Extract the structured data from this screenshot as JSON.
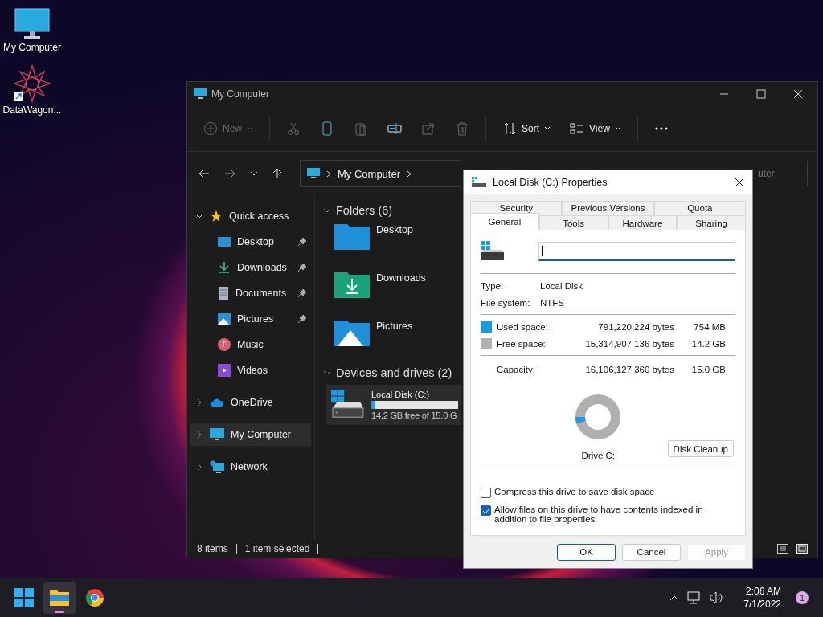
{
  "desktop_icons": [
    {
      "label": "My Computer",
      "kind": "computer"
    },
    {
      "label": "DataWagon...",
      "kind": "app"
    }
  ],
  "explorer": {
    "title": "My Computer",
    "toolbar": [
      {
        "kind": "new",
        "label": "New",
        "disabled": true
      },
      {
        "kind": "cut",
        "disabled": true
      },
      {
        "kind": "copy",
        "disabled": false
      },
      {
        "kind": "paste",
        "disabled": true
      },
      {
        "kind": "rename",
        "disabled": false
      },
      {
        "kind": "share",
        "disabled": true
      },
      {
        "kind": "delete",
        "disabled": true
      },
      {
        "kind": "sort",
        "label": "Sort",
        "disabled": false
      },
      {
        "kind": "view",
        "label": "View",
        "disabled": false
      },
      {
        "kind": "more",
        "disabled": false
      }
    ],
    "address": {
      "path": "My Computer"
    },
    "search": {
      "placeholder": "uter"
    },
    "sidebar": [
      {
        "label": "Quick access",
        "kind": "star",
        "expanded": true,
        "selected": false,
        "children": [
          {
            "label": "Desktop",
            "kind": "desktop",
            "pinned": true,
            "selected": false
          },
          {
            "label": "Downloads",
            "kind": "download",
            "pinned": true,
            "selected": false
          },
          {
            "label": "Documents",
            "kind": "document",
            "pinned": true,
            "selected": false
          },
          {
            "label": "Pictures",
            "kind": "picture",
            "pinned": true,
            "selected": false
          },
          {
            "label": "Music",
            "kind": "music",
            "pinned": false,
            "selected": false
          },
          {
            "label": "Videos",
            "kind": "video",
            "pinned": false,
            "selected": false
          }
        ]
      },
      {
        "label": "OneDrive",
        "kind": "cloud",
        "expanded": false,
        "selected": false
      },
      {
        "label": "My Computer",
        "kind": "computer",
        "expanded": false,
        "selected": true
      },
      {
        "label": "Network",
        "kind": "network",
        "expanded": false,
        "selected": false
      }
    ],
    "sections": [
      {
        "title": "Folders (6)",
        "expanded": true,
        "items": [
          {
            "name": "Desktop",
            "kind": "desktop"
          },
          {
            "name": "Downloads",
            "kind": "download"
          },
          {
            "name": "Pictures",
            "kind": "picture"
          }
        ]
      },
      {
        "title": "Devices and drives (2)",
        "expanded": true,
        "drives": [
          {
            "name": "Local Disk (C:)",
            "level": 0.05,
            "free": "14.2 GB free of 15.0 G",
            "selected": true
          }
        ]
      }
    ],
    "status_bar": [
      "8 items",
      "1 item selected"
    ]
  },
  "dialog": {
    "title": "Local Disk (C:) Properties",
    "tab_rows": [
      [
        {
          "label": "Security",
          "selected": false
        },
        {
          "label": "Previous Versions",
          "selected": false
        },
        {
          "label": "Quota",
          "selected": false
        }
      ],
      [
        {
          "label": "General",
          "selected": true
        },
        {
          "label": "Tools",
          "selected": false
        },
        {
          "label": "Hardware",
          "selected": false
        },
        {
          "label": "Sharing",
          "selected": false
        }
      ]
    ],
    "info": [
      {
        "label": "Type:",
        "value": "Local Disk"
      },
      {
        "label": "File system:",
        "value": "NTFS"
      }
    ],
    "space": [
      {
        "label": "Used space:",
        "bytes": "791,220,224 bytes",
        "size": "754 MB",
        "color": "#1e9be0"
      },
      {
        "label": "Free space:",
        "bytes": "15,314,907,136 bytes",
        "size": "14.2 GB",
        "color": "#b0b0b0"
      }
    ],
    "capacity": {
      "label": "Capacity:",
      "bytes": "16,106,127,360 bytes",
      "size": "15.0 GB"
    },
    "drive_label": "Drive C:",
    "cleanup_button": "Disk Cleanup",
    "checkboxes": [
      {
        "label": "Compress this drive to save disk space",
        "checked": false
      },
      {
        "label": "Allow files on this drive to have contents indexed in addition to file properties",
        "checked": true
      }
    ],
    "buttons": [
      {
        "label": "OK",
        "default": true,
        "disabled": false
      },
      {
        "label": "Cancel",
        "default": false,
        "disabled": false
      },
      {
        "label": "Apply",
        "default": false,
        "disabled": true
      }
    ]
  },
  "taskbar": {
    "apps": [
      {
        "kind": "start",
        "active": false
      },
      {
        "kind": "explorer",
        "active": true
      },
      {
        "kind": "browser",
        "active": false
      }
    ],
    "time": "2:06 AM",
    "date": "7/1/2022",
    "notifications": "1"
  }
}
